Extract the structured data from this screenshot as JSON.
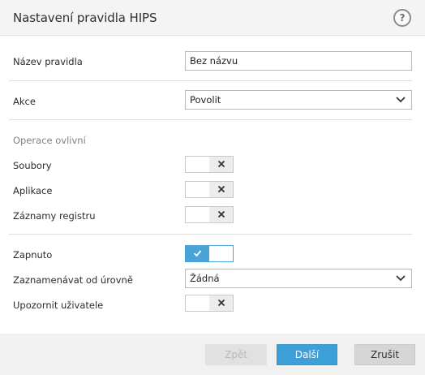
{
  "dialog": {
    "title": "Nastavení pravidla HIPS",
    "help_glyph": "?"
  },
  "form": {
    "rule_name": {
      "label": "Název pravidla",
      "value": "Bez názvu"
    },
    "action": {
      "label": "Akce",
      "value": "Povolit"
    },
    "operations_section": "Operace ovlivní",
    "files": {
      "label": "Soubory",
      "enabled": false
    },
    "applications": {
      "label": "Aplikace",
      "enabled": false
    },
    "registry": {
      "label": "Záznamy registru",
      "enabled": false
    },
    "enabled": {
      "label": "Zapnuto",
      "enabled": true
    },
    "log_level": {
      "label": "Zaznamenávat od úrovně",
      "value": "Žádná"
    },
    "notify_user": {
      "label": "Upozornit uživatele",
      "enabled": false
    }
  },
  "footer": {
    "back_label": "Zpět",
    "next_label": "Další",
    "cancel_label": "Zrušit"
  },
  "colors": {
    "accent": "#3d9fd8",
    "toggle_on": "#4aa3d6"
  }
}
